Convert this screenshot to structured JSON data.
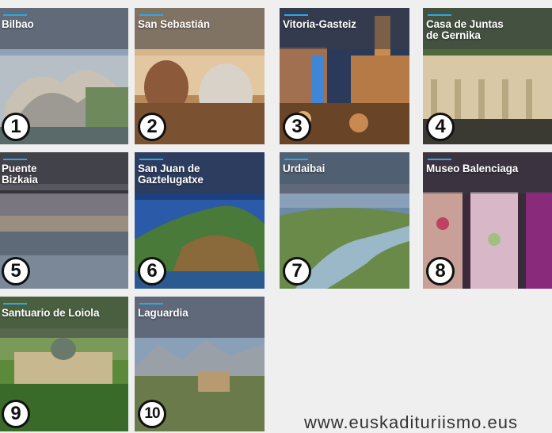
{
  "tiles": [
    {
      "title": "Bilbao",
      "number": "1"
    },
    {
      "title": "San Sebastián",
      "number": "2"
    },
    {
      "title": "Vitoria-Gasteiz",
      "number": "3"
    },
    {
      "title": "Casa de Juntas\nde Gernika",
      "number": "4"
    },
    {
      "title": "Puente\nBizkaia",
      "number": "5"
    },
    {
      "title": "San Juan de\nGaztelugatxe",
      "number": "6"
    },
    {
      "title": "Urdaibai",
      "number": "7"
    },
    {
      "title": "Museo Balenciaga",
      "number": "8"
    },
    {
      "title": "Santuario de Loiola",
      "number": "9"
    },
    {
      "title": "Laguardia",
      "number": "10"
    }
  ],
  "website": "www.euskadituriismo.eus",
  "accent_color": "#2aa9e8"
}
